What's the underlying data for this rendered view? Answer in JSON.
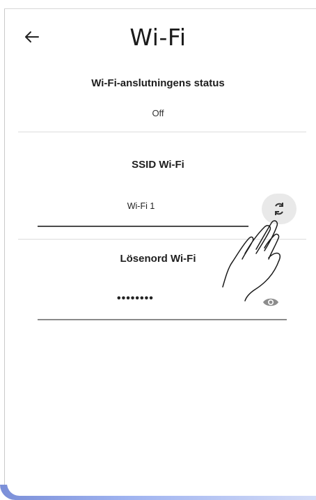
{
  "header": {
    "title": "Wi-Fi",
    "back_icon": "arrow-left-icon"
  },
  "status": {
    "label": "Wi-Fi-anslutningens status",
    "value": "Off"
  },
  "ssid": {
    "label": "SSID Wi-Fi",
    "value": "Wi-Fi 1",
    "refresh_icon": "refresh-icon"
  },
  "password": {
    "label": "Lösenord Wi-Fi",
    "value": "••••••••",
    "visibility_icon": "eye-icon"
  },
  "overlay": {
    "gesture_icon": "tap-hand-icon"
  }
}
